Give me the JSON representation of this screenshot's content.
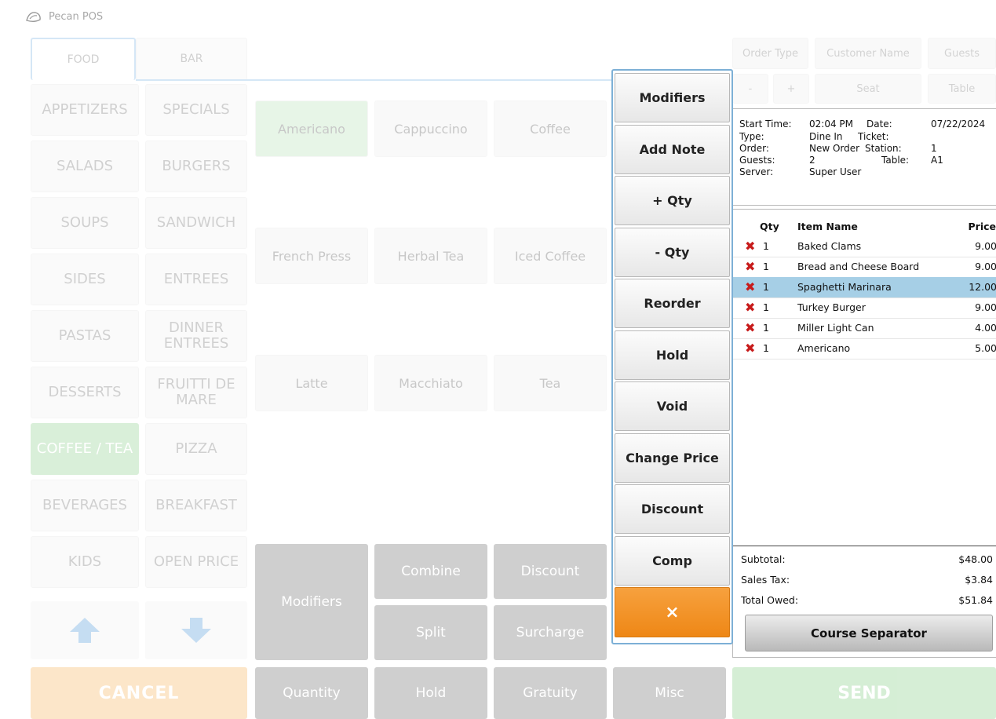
{
  "app": {
    "title": "Pecan POS"
  },
  "tabs": [
    {
      "label": "FOOD",
      "selected": true
    },
    {
      "label": "BAR",
      "selected": false
    }
  ],
  "categories": [
    {
      "label": "APPETIZERS"
    },
    {
      "label": "SPECIALS"
    },
    {
      "label": "SALADS"
    },
    {
      "label": "BURGERS"
    },
    {
      "label": "SOUPS"
    },
    {
      "label": "SANDWICH"
    },
    {
      "label": "SIDES"
    },
    {
      "label": "ENTREES"
    },
    {
      "label": "PASTAS"
    },
    {
      "label": "DINNER ENTREES"
    },
    {
      "label": "DESSERTS"
    },
    {
      "label": "FRUITTI DE MARE"
    },
    {
      "label": "COFFEE / TEA",
      "selected": true
    },
    {
      "label": "PIZZA"
    },
    {
      "label": "BEVERAGES"
    },
    {
      "label": "BREAKFAST"
    },
    {
      "label": "KIDS"
    },
    {
      "label": "OPEN PRICE"
    }
  ],
  "items": [
    {
      "label": "Americano",
      "selected": true
    },
    {
      "label": "Cappuccino"
    },
    {
      "label": "Coffee"
    },
    {
      "label": "French Press"
    },
    {
      "label": "Herbal Tea"
    },
    {
      "label": "Iced Coffee"
    },
    {
      "label": "Latte"
    },
    {
      "label": "Macchiato"
    },
    {
      "label": "Tea"
    }
  ],
  "actions": {
    "modifiers": "Modifiers",
    "combine": "Combine",
    "discount": "Discount",
    "split": "Split",
    "surcharge": "Surcharge",
    "quantity": "Quantity",
    "hold": "Hold",
    "gratuity": "Gratuity",
    "misc": "Misc",
    "cancel": "CANCEL",
    "send": "SEND"
  },
  "order_header": {
    "order_type": "Order Type",
    "customer_name": "Customer Name",
    "guests": "Guests",
    "minus": "-",
    "plus": "+",
    "seat": "Seat",
    "table": "Table"
  },
  "popup": {
    "buttons": [
      "Modifiers",
      "Add Note",
      "+ Qty",
      "- Qty",
      "Reorder",
      "Hold",
      "Void",
      "Change Price",
      "Discount",
      "Comp"
    ],
    "close": "×"
  },
  "ticket_info": {
    "start_time_label": "Start Time:",
    "start_time": "02:04 PM",
    "date_label": "Date:",
    "date": "07/22/2024",
    "type_label": "Type:",
    "type": "Dine In",
    "ticket_label": "Ticket:",
    "ticket": "",
    "order_label": "Order:",
    "order": "New Order",
    "station_label": "Station:",
    "station": "1",
    "guests_label": "Guests:",
    "guests": "2",
    "table_label": "Table:",
    "table": "A1",
    "server_label": "Server:",
    "server": "Super User"
  },
  "order": {
    "columns": {
      "qty": "Qty",
      "name": "Item Name",
      "price": "Price"
    },
    "lines": [
      {
        "qty": "1",
        "name": "Baked Clams",
        "price": "9.00"
      },
      {
        "qty": "1",
        "name": "Bread and Cheese Board",
        "price": "9.00"
      },
      {
        "qty": "1",
        "name": "Spaghetti Marinara",
        "price": "12.00",
        "selected": true
      },
      {
        "qty": "1",
        "name": "Turkey Burger",
        "price": "9.00"
      },
      {
        "qty": "1",
        "name": "Miller Light Can",
        "price": "4.00"
      },
      {
        "qty": "1",
        "name": "Americano",
        "price": "5.00"
      }
    ],
    "subtotal_label": "Subtotal:",
    "subtotal": "$48.00",
    "tax_label": "Sales Tax:",
    "tax": "$3.84",
    "total_label": "Total Owed:",
    "total": "$51.84",
    "course_separator": "Course Separator"
  },
  "colors": {
    "accent_orange": "#ee8716",
    "selected_green": "#8ccf8c",
    "selected_row": "#a6cfe6",
    "popup_border": "#7db0d6"
  }
}
